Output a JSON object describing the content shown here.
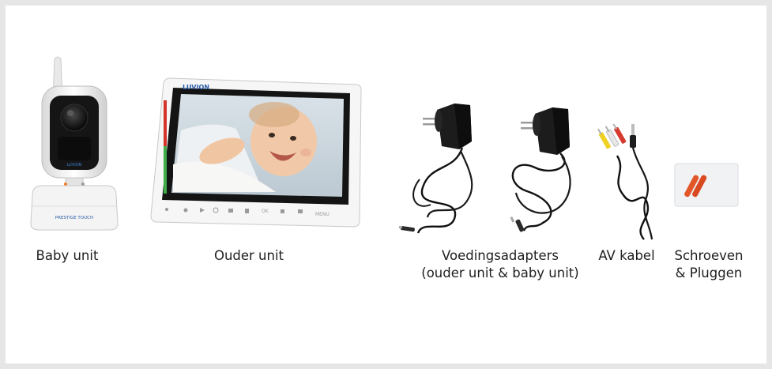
{
  "brand": "LUVION",
  "camera_badge": "PRESTIGE TOUCH",
  "monitor_button_labels": [
    "OK",
    "MENU"
  ],
  "items": [
    {
      "name": "baby-unit",
      "caption": [
        "Baby unit"
      ]
    },
    {
      "name": "parent-unit",
      "caption": [
        "Ouder unit"
      ]
    },
    {
      "name": "power-adapters",
      "caption": [
        "Voedingsadapters",
        "(ouder unit & baby unit)"
      ]
    },
    {
      "name": "av-cable",
      "caption": [
        "AV kabel"
      ]
    },
    {
      "name": "screws-plugs",
      "caption": [
        "Schroeven",
        "& Pluggen"
      ]
    }
  ],
  "colors": {
    "background": "#e6e6e6",
    "panel": "#ffffff",
    "device_white": "#f4f4f4",
    "adapter_black": "#1a1a1a",
    "plug_orange": "#e2572a",
    "brand_blue": "#2b5ea8"
  }
}
